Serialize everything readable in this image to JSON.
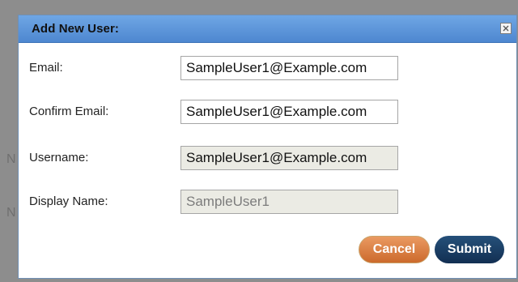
{
  "dialog": {
    "title": "Add New User:",
    "fields": [
      {
        "label": "Email:",
        "value": "SampleUser1@Example.com",
        "disabled": false
      },
      {
        "label": "Confirm Email:",
        "value": "SampleUser1@Example.com",
        "disabled": false
      },
      {
        "label": "Username:",
        "value": "SampleUser1@Example.com",
        "disabled": true
      },
      {
        "label": "Display Name:",
        "value": "SampleUser1",
        "disabled": true
      }
    ],
    "cancel_label": "Cancel",
    "submit_label": "Submit"
  },
  "icons": {
    "close": "close-icon"
  },
  "colors": {
    "titlebar": "#5b93d8",
    "cancel": "#db7f42",
    "submit": "#1b3f66",
    "disabled_field": "#ebebe4"
  }
}
